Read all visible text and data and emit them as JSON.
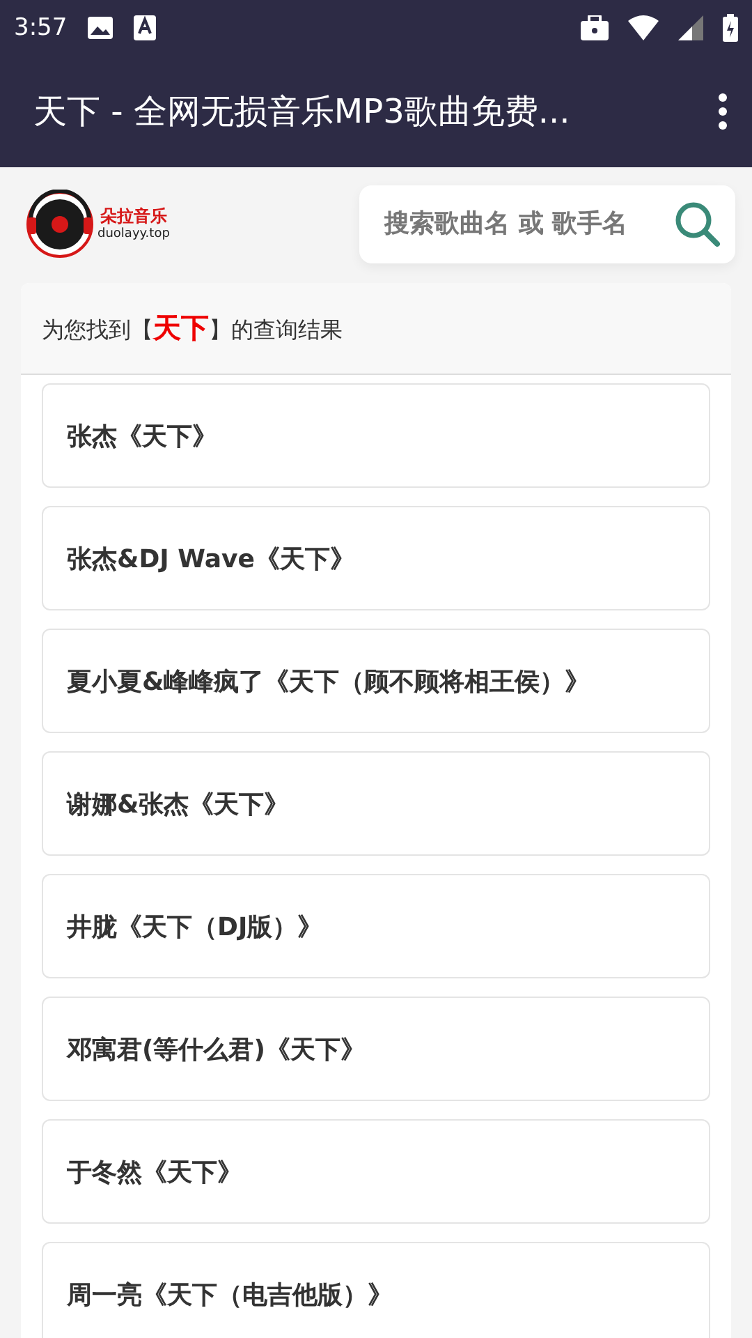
{
  "status_bar": {
    "time": "3:57"
  },
  "app_bar": {
    "title": "天下 - 全网无损音乐MP3歌曲免费..."
  },
  "logo": {
    "name": "朵拉音乐",
    "domain": "duolayy.top"
  },
  "search": {
    "placeholder": "搜索歌曲名 或 歌手名"
  },
  "results": {
    "heading_prefix": "为您找到【",
    "keyword": "天下",
    "heading_suffix": "】的查询结果",
    "items": [
      {
        "title": "张杰《天下》"
      },
      {
        "title": "张杰&DJ Wave《天下》"
      },
      {
        "title": "夏小夏&峰峰疯了《天下（顾不顾将相王侯）》"
      },
      {
        "title": "谢娜&张杰《天下》"
      },
      {
        "title": "井胧《天下（DJ版）》"
      },
      {
        "title": "邓寓君(等什么君)《天下》"
      },
      {
        "title": "于冬然《天下》"
      },
      {
        "title": "周一亮《天下（电吉他版）》"
      }
    ]
  }
}
